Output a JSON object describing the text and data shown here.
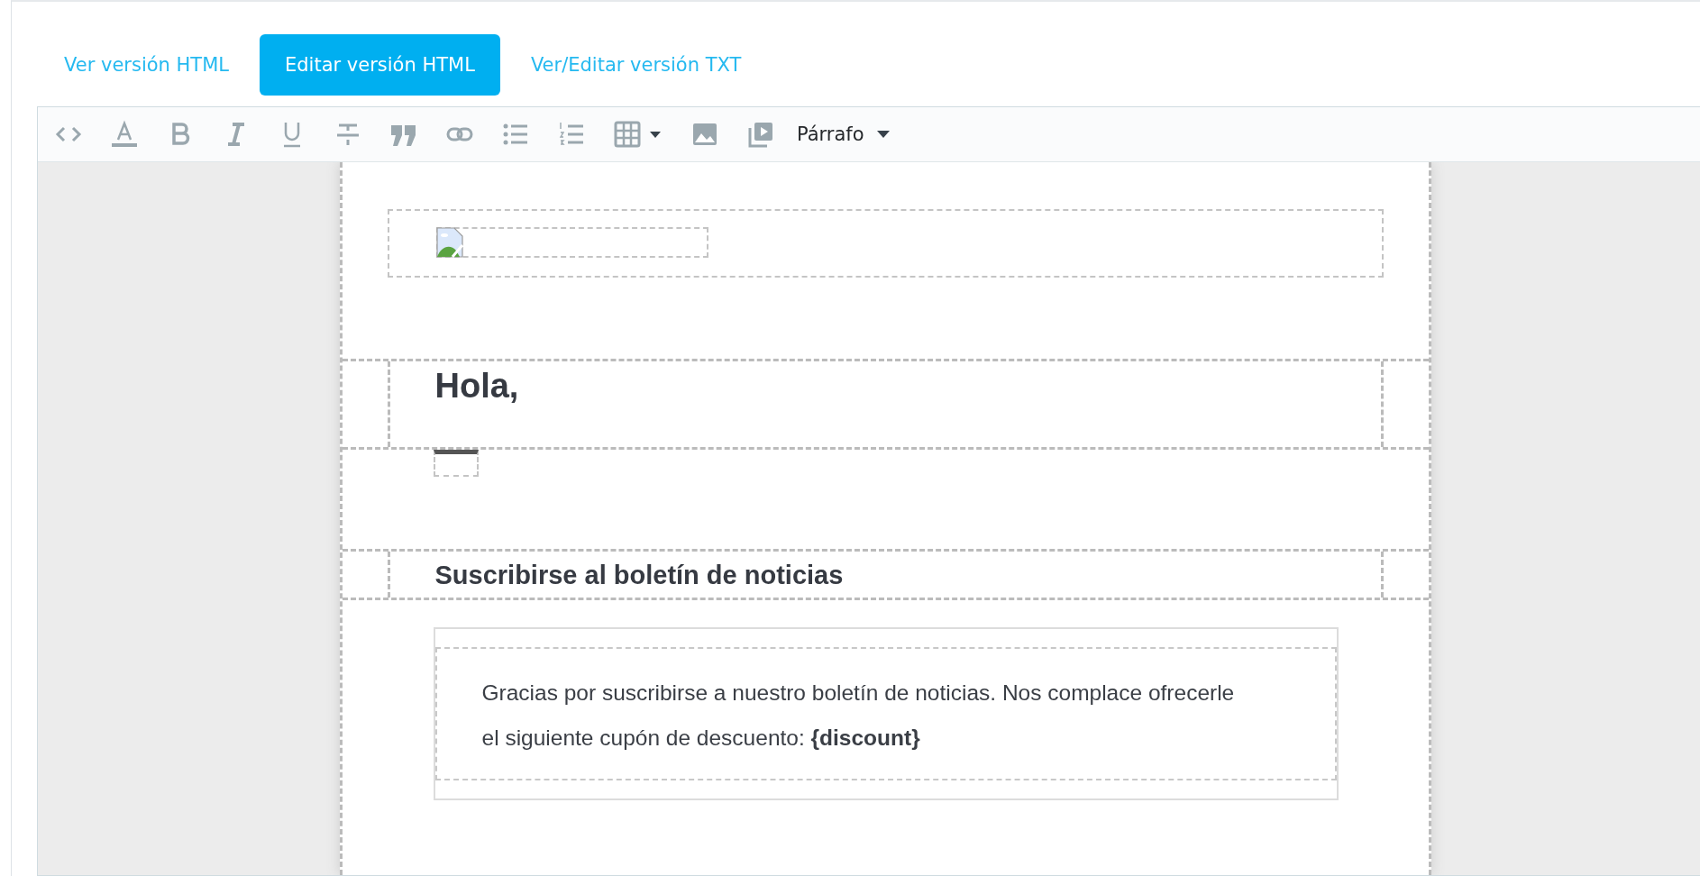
{
  "tabs": [
    {
      "label": "Ver versión HTML",
      "selected": false
    },
    {
      "label": "Editar versión HTML",
      "selected": true
    },
    {
      "label": "Ver/Editar versión TXT",
      "selected": false
    }
  ],
  "toolbar": [
    {
      "kind": "code"
    },
    {
      "kind": "color"
    },
    {
      "kind": "bold"
    },
    {
      "kind": "italic"
    },
    {
      "kind": "underline"
    },
    {
      "kind": "strike"
    },
    {
      "kind": "quote"
    },
    {
      "kind": "link"
    },
    {
      "kind": "bullets"
    },
    {
      "kind": "numbers"
    },
    {
      "kind": "table"
    },
    {
      "kind": "image"
    },
    {
      "kind": "video"
    }
  ],
  "format_dropdown": {
    "label": "Párrafo"
  },
  "email": {
    "heading": "Hola,",
    "subheading": "Suscribirse al boletín de noticias",
    "body": "Gracias por suscribirse a nuestro boletín de noticias. Nos complace ofrecerle el siguiente cupón de descuento: **{discount}**"
  }
}
